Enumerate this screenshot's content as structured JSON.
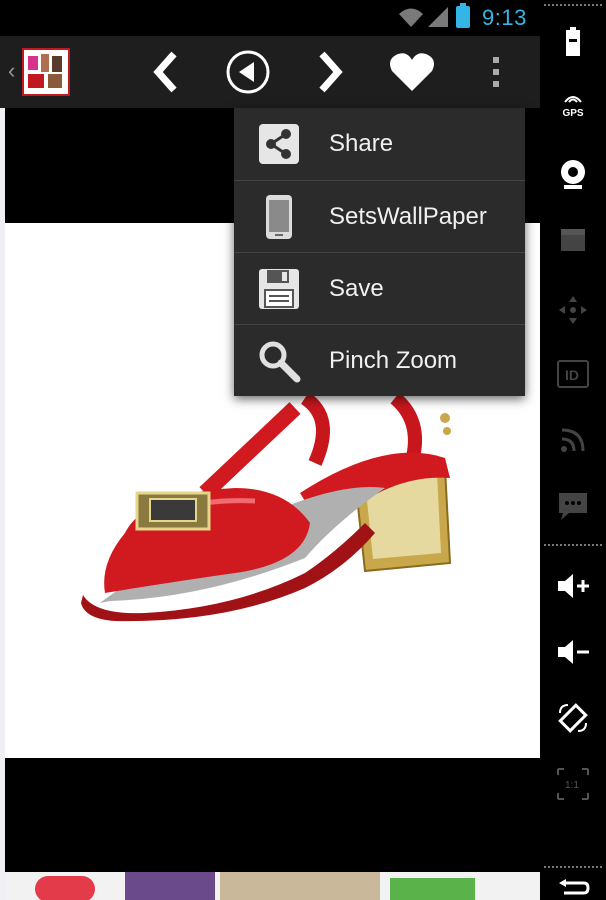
{
  "status_bar": {
    "time": "9:13",
    "icons": [
      "wifi-icon",
      "signal-icon",
      "battery-icon"
    ],
    "accent_color": "#33b5e5"
  },
  "action_bar": {
    "buttons": [
      "previous-button",
      "play-button",
      "next-button",
      "favorite-button",
      "overflow-menu-button"
    ],
    "background": "#1e1e1e"
  },
  "overflow_menu": {
    "items": [
      {
        "label": "Share",
        "icon": "share-icon"
      },
      {
        "label": "SetsWallPaper",
        "icon": "phone-icon"
      },
      {
        "label": "Save",
        "icon": "floppy-disk-icon"
      },
      {
        "label": "Pinch Zoom",
        "icon": "magnifier-icon"
      }
    ]
  },
  "content": {
    "image": "red-sandal-photo",
    "image_colors": {
      "sandal": "#d11a20",
      "heel": "#c8a84a"
    }
  },
  "side_panel": {
    "gps_label": "GPS",
    "icons": [
      "battery-icon",
      "gps-icon",
      "webcam-icon",
      "clapper-icon",
      "dpad-icon",
      "id-icon",
      "rss-icon",
      "sms-icon",
      "volume-up-icon",
      "volume-down-icon",
      "rotate-icon",
      "scale-icon",
      "back-icon"
    ]
  }
}
